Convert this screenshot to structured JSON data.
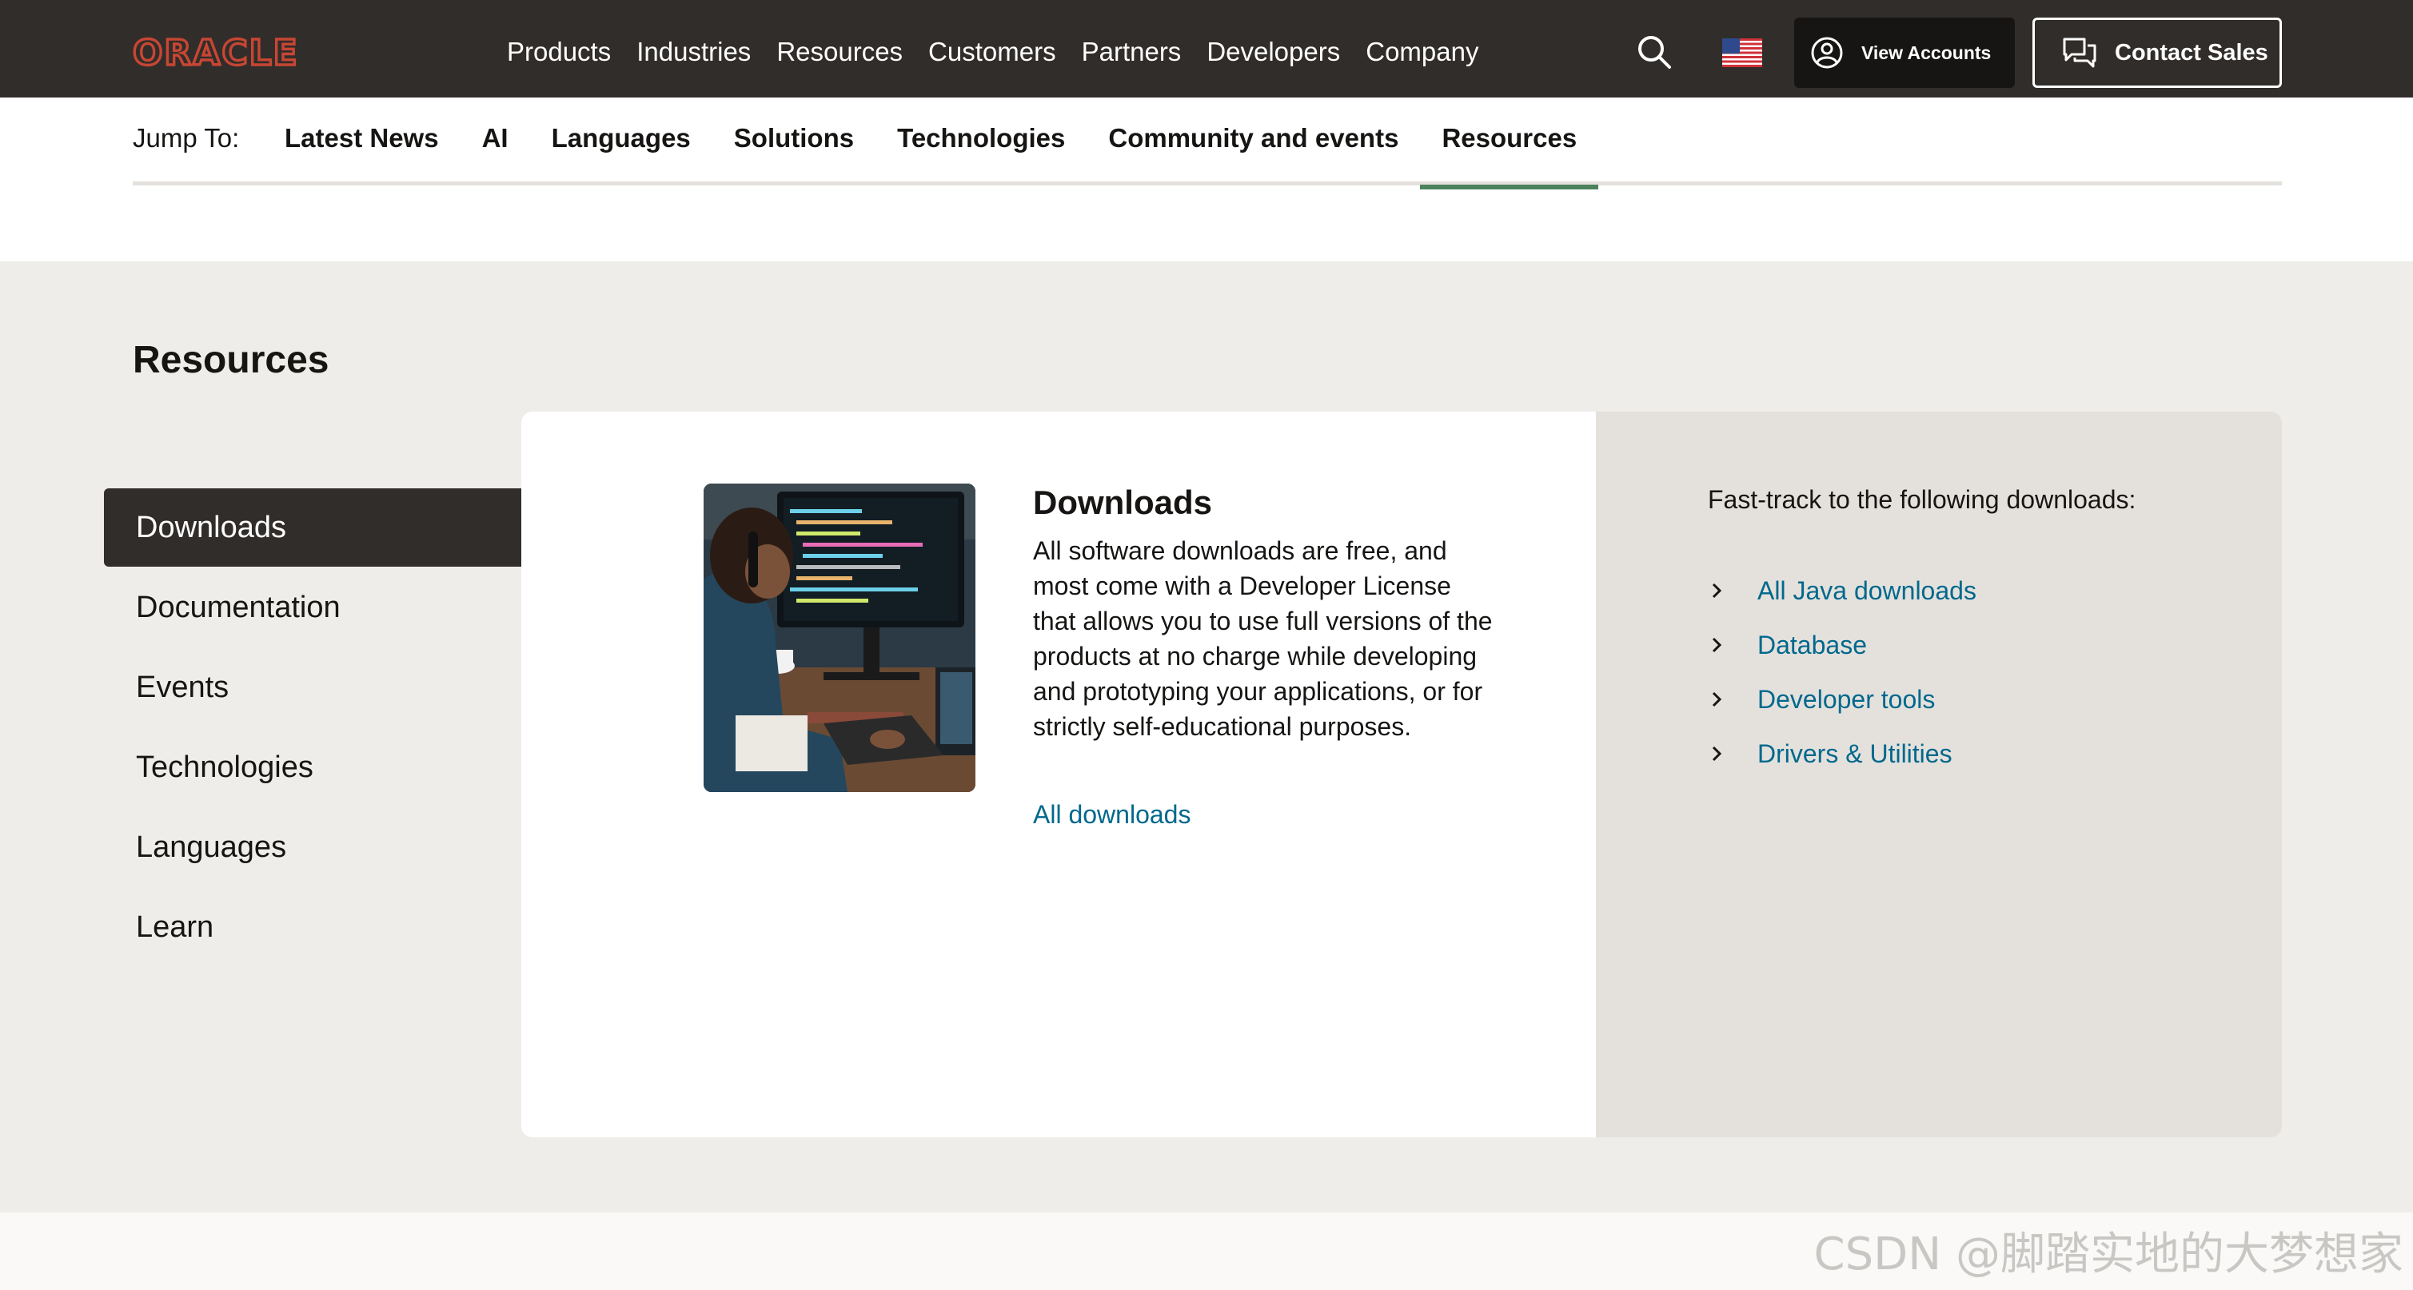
{
  "brand": {
    "logo_text": "ORACLE",
    "logo_color": "#c74634"
  },
  "topnav": {
    "items": [
      "Products",
      "Industries",
      "Resources",
      "Customers",
      "Partners",
      "Developers",
      "Company"
    ],
    "view_accounts": "View Accounts",
    "contact_sales": "Contact Sales"
  },
  "jumpbar": {
    "label": "Jump To:",
    "links": [
      "Latest News",
      "AI",
      "Languages",
      "Solutions",
      "Technologies",
      "Community and events",
      "Resources"
    ],
    "active": "Resources"
  },
  "resources": {
    "title": "Resources",
    "menu": [
      "Downloads",
      "Documentation",
      "Events",
      "Technologies",
      "Languages",
      "Learn"
    ],
    "active_menu": "Downloads",
    "card": {
      "heading": "Downloads",
      "body": "All software downloads are free, and most come with a Developer License that allows you to use full versions of the products at no charge while developing and prototyping your applications, or for strictly self-educational purposes.",
      "link": "All downloads"
    },
    "fasttrack": {
      "lead": "Fast-track to the following downloads:",
      "links": [
        "All Java downloads",
        "Database",
        "Developer tools",
        "Drivers & Utilities"
      ]
    }
  },
  "watermark": "CSDN @脚踏实地的大梦想家",
  "colors": {
    "topbar": "#312d2a",
    "link": "#00688c",
    "active_underline": "#4c825c",
    "section_bg": "#efedea"
  }
}
